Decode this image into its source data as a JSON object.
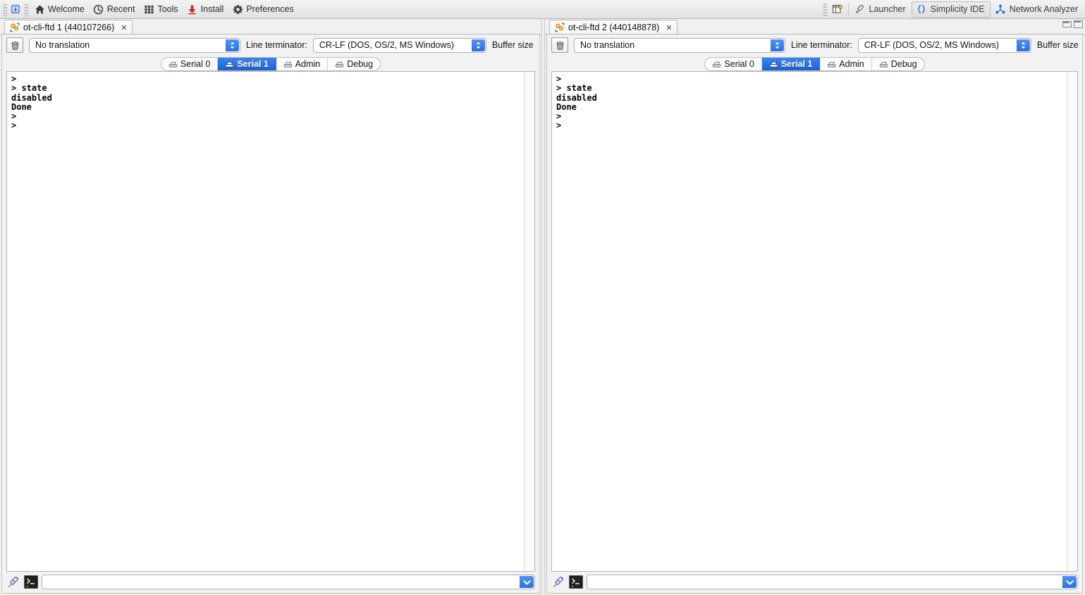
{
  "toolbar": {
    "left_items": [
      {
        "label": "Welcome",
        "icon": "home-icon"
      },
      {
        "label": "Recent",
        "icon": "clock-icon"
      },
      {
        "label": "Tools",
        "icon": "grid-icon"
      },
      {
        "label": "Install",
        "icon": "download-icon"
      },
      {
        "label": "Preferences",
        "icon": "gear-icon"
      }
    ],
    "right_items": [
      {
        "label": "Launcher",
        "icon": "rocket-icon",
        "active": false
      },
      {
        "label": "Simplicity IDE",
        "icon": "braces-icon",
        "active": true
      },
      {
        "label": "Network Analyzer",
        "icon": "network-icon",
        "active": false
      }
    ],
    "chip_icon": "microchip-icon",
    "new-perspective_icon": "new-perspective-icon"
  },
  "window_controls": {
    "minimize": "Minimize",
    "maximize": "Maximize"
  },
  "panes": [
    {
      "tab": {
        "title": "ot-cli-ftd 1 (440107266)",
        "close": "✕",
        "icon": "serial-gears-icon"
      },
      "controls": {
        "trash_tooltip": "Clear console",
        "translation": "No translation",
        "line_terminator_label": "Line terminator:",
        "line_terminator": "CR-LF  (DOS, OS/2, MS Windows)",
        "buffer_size_label": "Buffer size"
      },
      "serial_tabs": [
        {
          "label": "Serial 0",
          "selected": false
        },
        {
          "label": "Serial 1",
          "selected": true
        },
        {
          "label": "Admin",
          "selected": false
        },
        {
          "label": "Debug",
          "selected": false
        }
      ],
      "console_text": ">\n> state\ndisabled\nDone\n>\n>",
      "command_input": {
        "value": "",
        "placeholder": ""
      }
    },
    {
      "tab": {
        "title": "ot-cli-ftd 2 (440148878)",
        "close": "✕",
        "icon": "serial-gears-icon"
      },
      "controls": {
        "trash_tooltip": "Clear console",
        "translation": "No translation",
        "line_terminator_label": "Line terminator:",
        "line_terminator": "CR-LF  (DOS, OS/2, MS Windows)",
        "buffer_size_label": "Buffer size"
      },
      "serial_tabs": [
        {
          "label": "Serial 0",
          "selected": false
        },
        {
          "label": "Serial 1",
          "selected": true
        },
        {
          "label": "Admin",
          "selected": false
        },
        {
          "label": "Debug",
          "selected": false
        }
      ],
      "console_text": ">\n> state\ndisabled\nDone\n>\n>",
      "command_input": {
        "value": "",
        "placeholder": ""
      }
    }
  ],
  "colors": {
    "accent_blue": "#2c6fe0",
    "tab_selected_blue": "#1b61d6",
    "toolbar_bg": "#eaeaea",
    "console_bg": "#ffffff",
    "console_fg": "#000000"
  }
}
